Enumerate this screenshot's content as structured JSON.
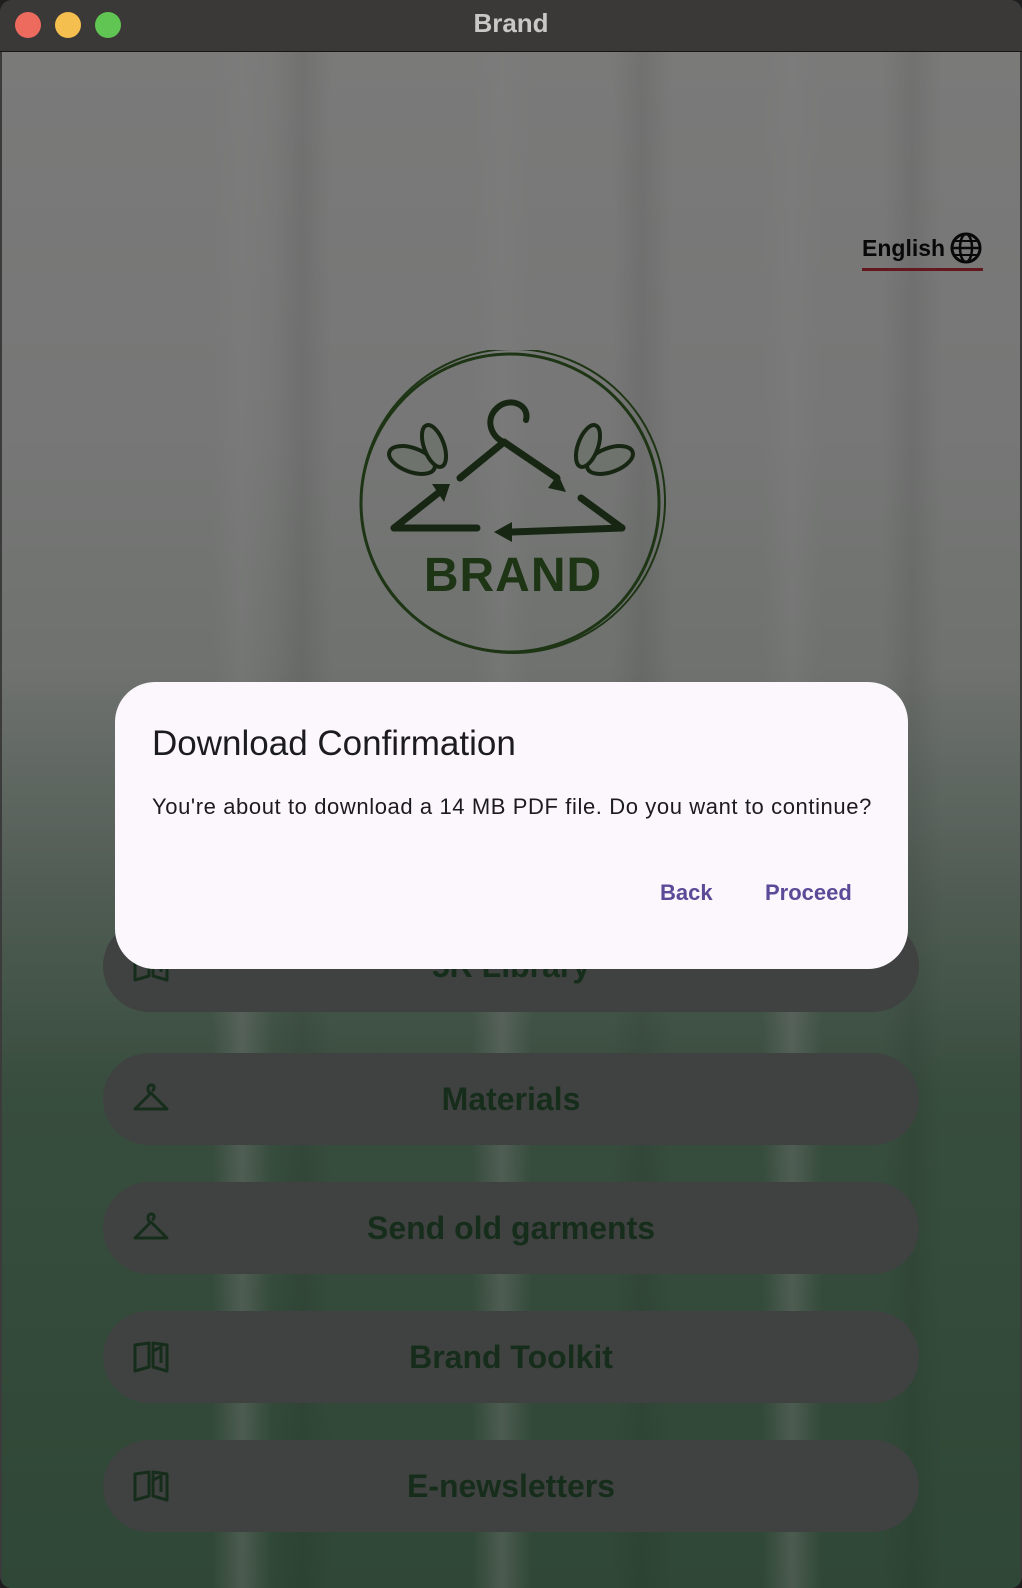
{
  "window": {
    "title": "Brand"
  },
  "language": {
    "label": "English",
    "icon": "globe-icon"
  },
  "logo": {
    "text": "BRAND",
    "icon": "hanger-recycle-logo",
    "color": "#3d6b2a"
  },
  "menu": {
    "items": [
      {
        "label": "5R Library",
        "icon": "book-icon"
      },
      {
        "label": "Materials",
        "icon": "hanger-icon"
      },
      {
        "label": "Send old garments",
        "icon": "hanger-icon"
      },
      {
        "label": "Brand Toolkit",
        "icon": "book-icon"
      },
      {
        "label": "E-newsletters",
        "icon": "book-icon"
      }
    ]
  },
  "dialog": {
    "title": "Download Confirmation",
    "message": "You're about to download a 14 MB PDF file. Do you want to continue?",
    "back_label": "Back",
    "proceed_label": "Proceed",
    "accent": "#5a4a98"
  },
  "colors": {
    "button_text": "#2d5a36",
    "language_underline": "#c4303a"
  }
}
